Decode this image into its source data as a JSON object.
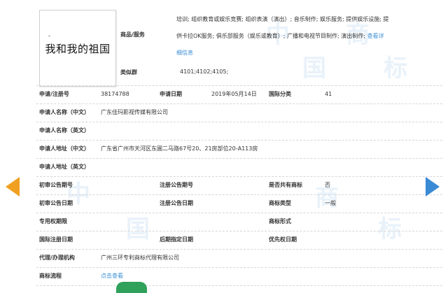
{
  "trademark": {
    "logo_text": "我和我的祖国",
    "goods_label": "商品/服务",
    "goods_line1": "培训; 组织教育或娱乐竞赛; 组织表演（演出）; 音乐制作; 娱乐服务; 提供娱乐设施; 提",
    "goods_line2": "供卡拉OK服务; 俱乐部服务（娱乐或教育）; 广播和电视节目制作; 演出制作; ",
    "goods_more": "查看详",
    "goods_line3": "细信息",
    "groups_label": "类似群",
    "groups_value": "4101;4102;4105;"
  },
  "fields": {
    "app_no_label": "申请/注册号",
    "app_no": "38174788",
    "app_date_label": "申请日期",
    "app_date": "2019年05月14日",
    "intl_class_label": "国际分类",
    "intl_class": "41",
    "applicant_cn_label": "申请人名称（中文）",
    "applicant_cn": "广东佳玛影视传媒有限公司",
    "applicant_en_label": "申请人名称（英文）",
    "address_cn_label": "申请人地址（中文）",
    "address_cn": "广东省广州市天河区东圃二马路67号20、21房部位20-A113房",
    "address_en_label": "申请人地址（英文）",
    "prelim_no_label": "初审公告期号",
    "reg_no_label": "注册公告期号",
    "shared_label": "是否共有商标",
    "shared": "否",
    "prelim_date_label": "初审公告日期",
    "reg_date_label": "注册公告日期",
    "tm_type_label": "商标类型",
    "tm_type": "一般",
    "exclusive_label": "专用权期限",
    "tm_form_label": "商标形式",
    "intl_reg_label": "国际注册日期",
    "later_date_label": "后期指定日期",
    "priority_label": "优先权日期",
    "agent_label": "代理/办理机构",
    "agent": "广州三环专利商标代理有限公司",
    "process_label": "商标流程",
    "process_link": "点击查看"
  },
  "watermark": [
    "中",
    "国",
    "商",
    "标",
    "中",
    "国",
    "商",
    "标"
  ],
  "colors": {
    "link": "#3b8fd6",
    "arrow_left": "#f0a020",
    "arrow_right": "#3a8ad6",
    "watermark": "#d8e9f6"
  },
  "icons": {
    "prev": "prev-arrow-icon",
    "next": "next-arrow-icon"
  }
}
